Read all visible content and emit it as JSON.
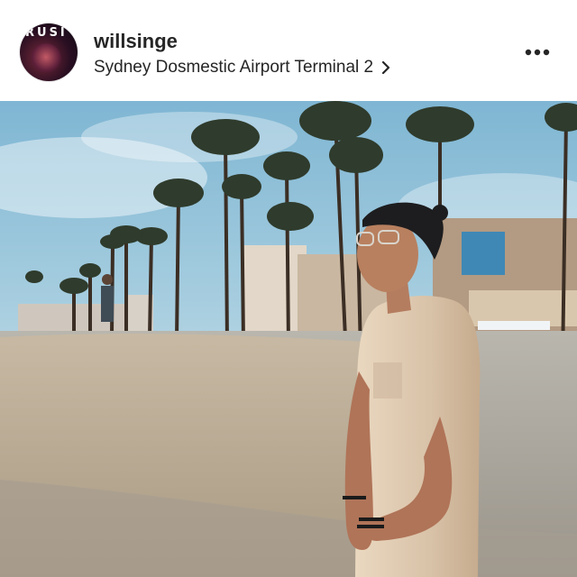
{
  "post": {
    "username": "willsinge",
    "location": "Sydney Dosmestic Airport Terminal 2",
    "avatar_text": "RUSI",
    "more_icon": "more-options-icon",
    "chevron_icon": "chevron-right-icon"
  },
  "colors": {
    "text": "#262626",
    "background": "#ffffff"
  }
}
